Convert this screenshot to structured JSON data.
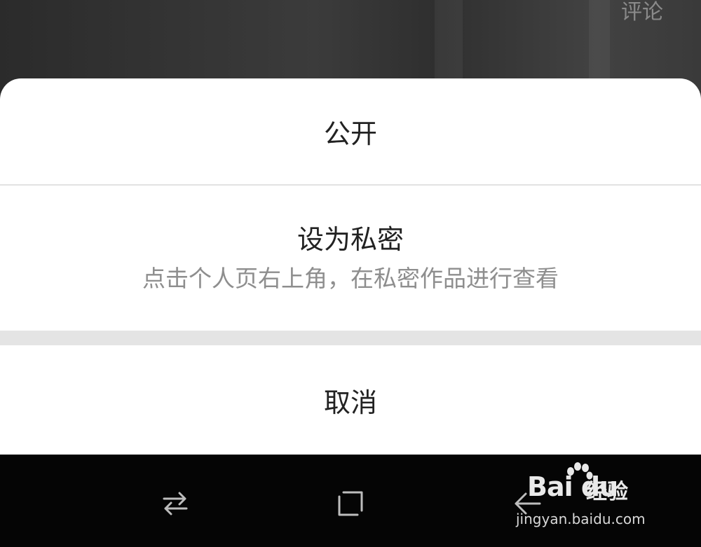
{
  "background": {
    "comment_label": "评论"
  },
  "sheet": {
    "option_public": "公开",
    "option_private_title": "设为私密",
    "option_private_subtitle": "点击个人页右上角，在私密作品进行查看",
    "option_cancel": "取消"
  },
  "navbar": {
    "icons": [
      "recent-apps-icon",
      "home-icon",
      "back-icon"
    ]
  },
  "watermark": {
    "logo": "Bai du",
    "brand": "经验",
    "url": "jingyan.baidu.com"
  }
}
